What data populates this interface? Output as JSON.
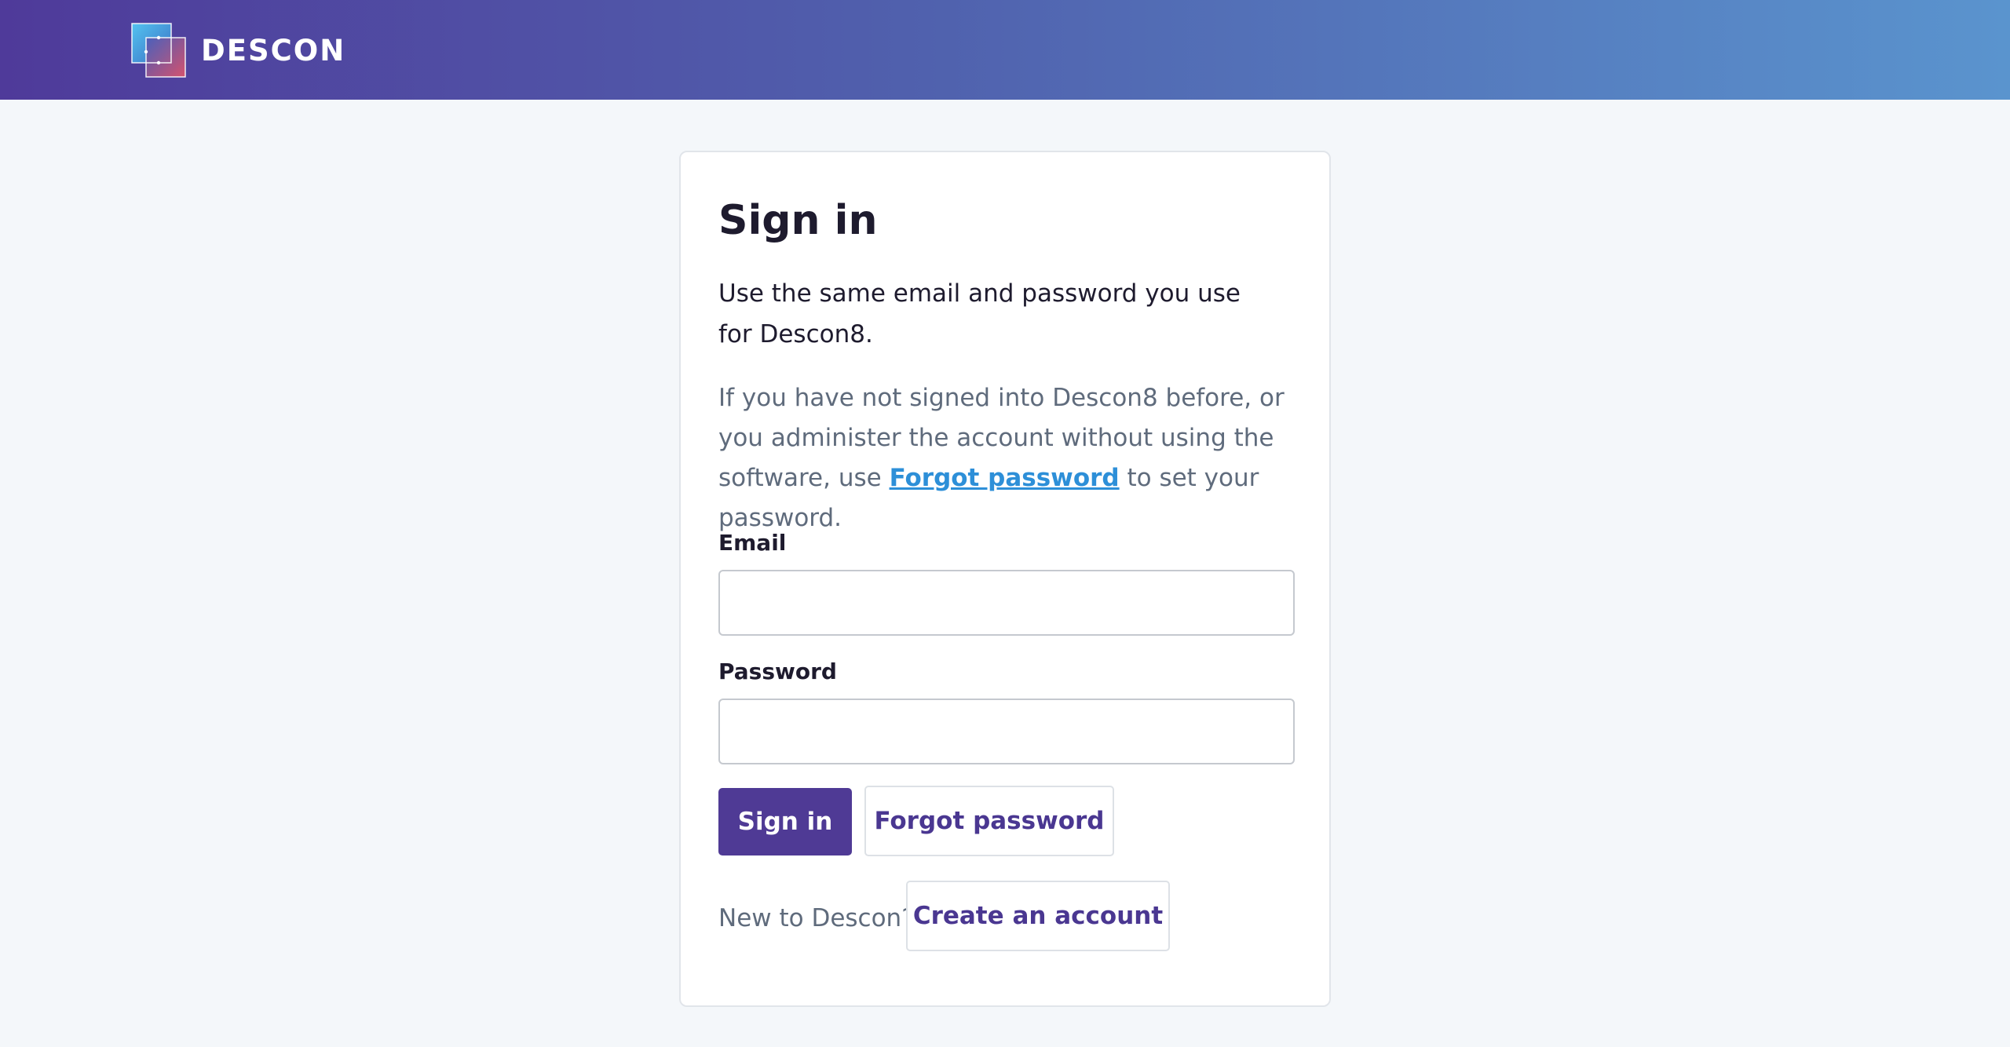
{
  "header": {
    "brand": "DESCON",
    "logo_icon": "descon-logo-icon",
    "gradient": [
      "#4f3a9a",
      "#5a94ce"
    ]
  },
  "signin": {
    "title": "Sign in",
    "intro": "Use the same email and password you use for Descon8.",
    "note_before": "If you have not signed into Descon8 before, or you administer the account without using the software, use ",
    "note_link": "Forgot password",
    "note_after": " to set your password.",
    "email_label": "Email",
    "email_value": "",
    "password_label": "Password",
    "password_value": "",
    "signin_button": "Sign in",
    "forgot_button": "Forgot password",
    "new_to": "New to Descon?",
    "create_button": "Create an account"
  },
  "colors": {
    "accent": "#4f3a95",
    "link": "#2d8fd8",
    "background": "#f4f7fa"
  }
}
